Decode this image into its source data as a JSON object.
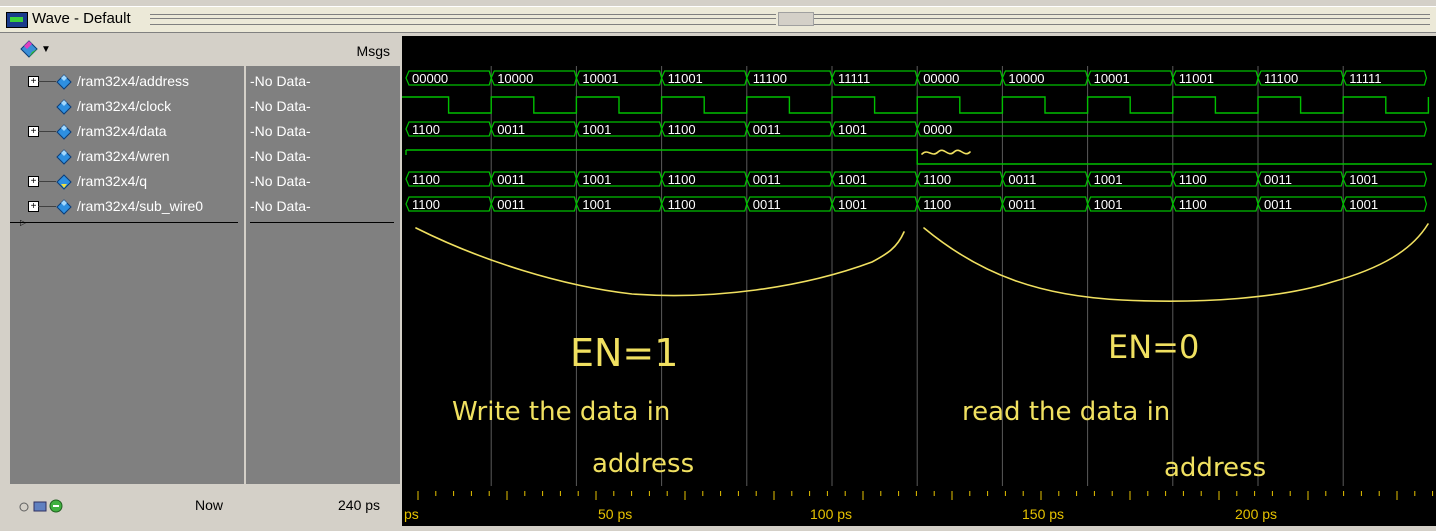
{
  "window": {
    "title": "Wave - Default"
  },
  "header": {
    "msgs_label": "Msgs",
    "menu_icon": "diamond-menu-icon"
  },
  "signals": [
    {
      "name": "/ram32x4/address",
      "value": "-No Data-",
      "expandable": true,
      "type": "bus"
    },
    {
      "name": "/ram32x4/clock",
      "value": "-No Data-",
      "expandable": false,
      "type": "bit"
    },
    {
      "name": "/ram32x4/data",
      "value": "-No Data-",
      "expandable": true,
      "type": "bus"
    },
    {
      "name": "/ram32x4/wren",
      "value": "-No Data-",
      "expandable": false,
      "type": "bit"
    },
    {
      "name": "/ram32x4/q",
      "value": "-No Data-",
      "expandable": true,
      "type": "bus"
    },
    {
      "name": "/ram32x4/sub_wire0",
      "value": "-No Data-",
      "expandable": true,
      "type": "bus"
    }
  ],
  "waves": {
    "address": [
      "00000",
      "10000",
      "10001",
      "11001",
      "11100",
      "11111",
      "00000",
      "10000",
      "10001",
      "11001",
      "11100",
      "11111"
    ],
    "data": [
      "1100",
      "0011",
      "1001",
      "1100",
      "0011",
      "1001",
      "0000"
    ],
    "q": [
      "1100",
      "0011",
      "1001",
      "1100",
      "0011",
      "1001",
      "1100",
      "0011",
      "1001",
      "1100",
      "0011",
      "1001"
    ],
    "sub_wire0": [
      "1100",
      "0011",
      "1001",
      "1100",
      "0011",
      "1001",
      "1100",
      "0011",
      "1001",
      "1100",
      "0011",
      "1001"
    ]
  },
  "annotations": {
    "left_label": "EN=1",
    "left_text_1": "Write the data in",
    "left_text_2": "address",
    "right_label": "EN=0",
    "right_text_1": "read the data in",
    "right_text_2": "address"
  },
  "footer": {
    "now_label": "Now",
    "now_value": "240 ps",
    "timeline_labels": [
      "ps",
      "50 ps",
      "100 ps",
      "150 ps",
      "200 ps"
    ]
  },
  "colors": {
    "wave": "#00c000",
    "annotation": "#f0e060",
    "timeline_text": "#e6c200",
    "background": "#000000"
  }
}
